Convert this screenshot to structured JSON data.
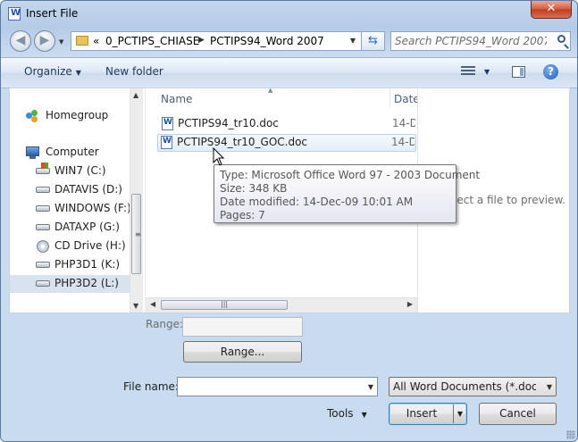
{
  "window": {
    "title": "Insert File",
    "close_label": "✕"
  },
  "address": {
    "overflow": "«",
    "segments": [
      "0_PCTIPS_CHIASE",
      "PCTIPS94_Word 2007"
    ]
  },
  "search": {
    "placeholder": "Search PCTIPS94_Word 2007"
  },
  "toolbar": {
    "organize": "Organize",
    "new_folder": "New folder",
    "help": "?"
  },
  "nav": {
    "homegroup": "Homegroup",
    "computer": "Computer",
    "drives": [
      {
        "label": "WIN7 (C:)",
        "type": "system"
      },
      {
        "label": "DATAVIS (D:)",
        "type": "disk"
      },
      {
        "label": "WINDOWS (F:)",
        "type": "disk"
      },
      {
        "label": "DATAXP (G:)",
        "type": "disk"
      },
      {
        "label": "CD Drive (H:)",
        "type": "cd"
      },
      {
        "label": "PHP3D1 (K:)",
        "type": "disk"
      },
      {
        "label": "PHP3D2 (L:)",
        "type": "disk",
        "selected": true
      }
    ]
  },
  "files": {
    "columns": {
      "name": "Name",
      "date": "Date"
    },
    "items": [
      {
        "name": "PCTIPS94_tr10.doc",
        "date": "14-D"
      },
      {
        "name": "PCTIPS94_tr10_GOC.doc",
        "date": "14-D"
      }
    ]
  },
  "tooltip": {
    "type": "Type: Microsoft Office Word 97 - 2003 Document",
    "size": "Size: 348 KB",
    "modified": "Date modified: 14-Dec-09 10:01 AM",
    "pages": "Pages: 7"
  },
  "preview": {
    "text": "Select a file to preview."
  },
  "range": {
    "label": "Range:",
    "value": "",
    "button": "Range..."
  },
  "filename": {
    "label": "File name:",
    "value": ""
  },
  "filter": {
    "selected": "All Word Documents (*.docx;*.docm;*.dotx;*.dotm;*.doc;*.dot;*.htm;*.html;*.url;*.rtf;*.mht;*.mhtml;*.xml)"
  },
  "actions": {
    "tools": "Tools",
    "insert": "Insert",
    "cancel": "Cancel"
  },
  "colors": {
    "accent": "#2e6bc2",
    "close": "#c03c1c",
    "tooltip_border": "#767676"
  }
}
